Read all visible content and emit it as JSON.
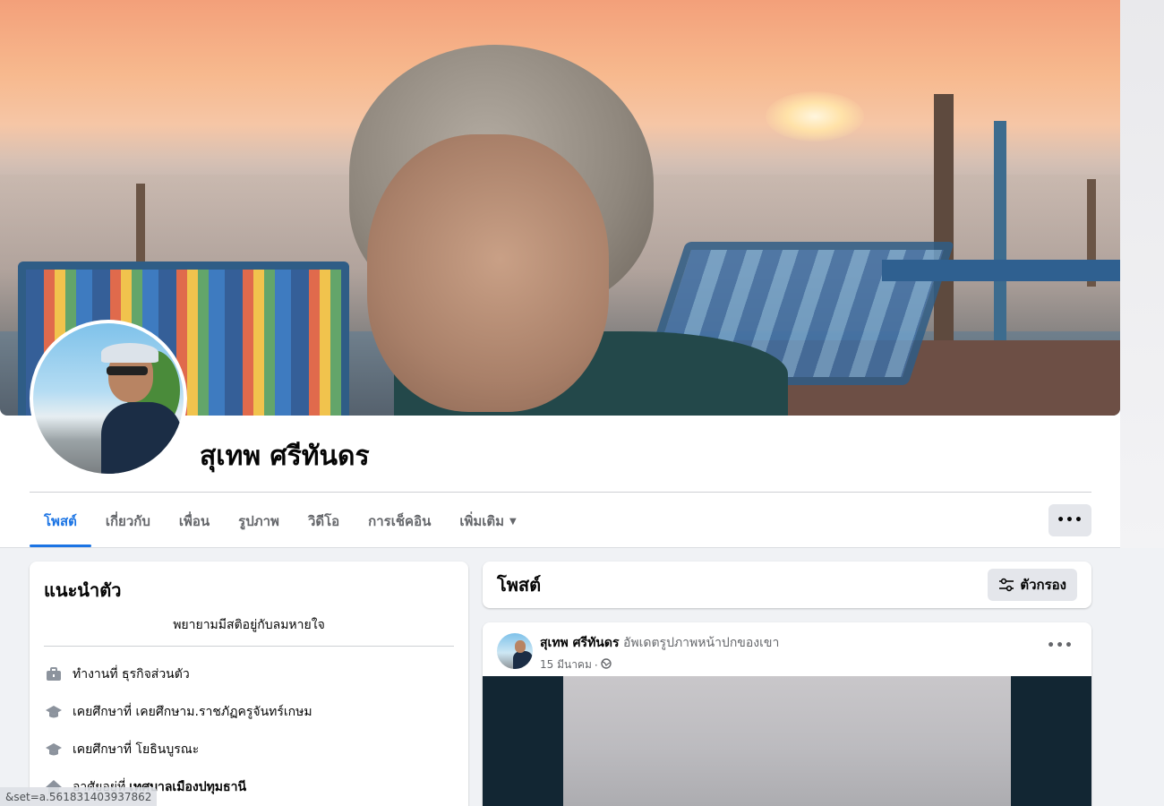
{
  "profile": {
    "name": "สุเทพ ศรีทันดร"
  },
  "tabs": [
    {
      "label": "โพสต์",
      "active": true
    },
    {
      "label": "เกี่ยวกับ",
      "active": false
    },
    {
      "label": "เพื่อน",
      "active": false
    },
    {
      "label": "รูปภาพ",
      "active": false
    },
    {
      "label": "วิดีโอ",
      "active": false
    },
    {
      "label": "การเช็คอิน",
      "active": false
    },
    {
      "label": "เพิ่มเติม",
      "active": false
    }
  ],
  "more_button": {
    "label": "•••"
  },
  "intro": {
    "title": "แนะนำตัว",
    "bio": "พยายามมีสติอยู่กับลมหายใจ",
    "items": [
      {
        "icon": "briefcase-icon",
        "text": "ทำงานที่ ธุรกิจส่วนตัว",
        "bold": ""
      },
      {
        "icon": "graduation-cap-icon",
        "text": "เคยศึกษาที่ เคยศึกษาม.ราชภัฏครูจันทร์เกษม",
        "bold": ""
      },
      {
        "icon": "graduation-cap-icon",
        "text": "เคยศึกษาที่ โยธินบูรณะ",
        "bold": ""
      },
      {
        "icon": "home-icon",
        "text": "อาศัยอยู่ที่",
        "bold": "เทศบาลเมืองปทุมธานี"
      }
    ]
  },
  "posts": {
    "title": "โพสต์",
    "filter_label": "ตัวกรอง"
  },
  "post": {
    "author": "สุเทพ ศรีทันดร",
    "action": "อัพเดตรูปภาพหน้าปกของเขา",
    "date": "15 มีนาคม",
    "date_sep": "·",
    "privacy_icon": "globe-icon",
    "menu_label": "•••"
  },
  "status_url": "&set=a.561831403937862",
  "colors": {
    "accent": "#1b74e4",
    "secondary_text": "#65676b",
    "button_bg": "#e4e6eb",
    "page_bg": "#f0f2f5"
  }
}
